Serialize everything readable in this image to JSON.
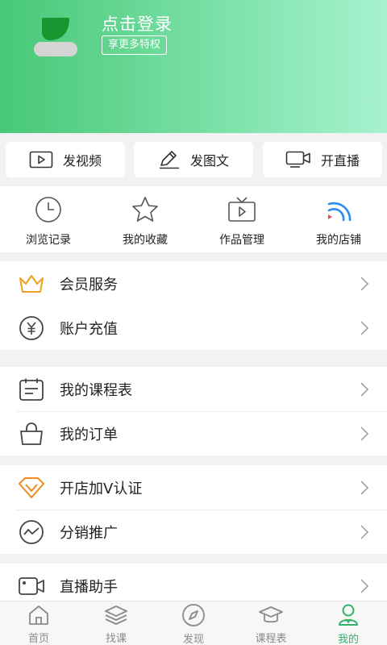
{
  "header": {
    "login_title": "点击登录",
    "privilege_badge": "享更多特权"
  },
  "quick_actions": [
    {
      "label": "发视频",
      "icon": "video-play-icon"
    },
    {
      "label": "发图文",
      "icon": "pen-icon"
    },
    {
      "label": "开直播",
      "icon": "live-camera-icon"
    }
  ],
  "shortcuts": [
    {
      "label": "浏览记录",
      "icon": "clock-icon"
    },
    {
      "label": "我的收藏",
      "icon": "star-icon"
    },
    {
      "label": "作品管理",
      "icon": "tv-icon"
    },
    {
      "label": "我的店铺",
      "icon": "signal-icon"
    }
  ],
  "menu": {
    "membership": "会员服务",
    "recharge": "账户充值",
    "schedule": "我的课程表",
    "orders": "我的订单",
    "v_certify": "开店加V认证",
    "distribution": "分销推广",
    "live_assistant": "直播助手"
  },
  "tabs": [
    {
      "label": "首页",
      "icon": "home-icon"
    },
    {
      "label": "找课",
      "icon": "layers-icon"
    },
    {
      "label": "发现",
      "icon": "compass-icon"
    },
    {
      "label": "课程表",
      "icon": "graduation-cap-icon"
    },
    {
      "label": "我的",
      "icon": "user-icon",
      "active": true
    }
  ],
  "colors": {
    "brand_green": "#2fb268",
    "header_start": "#47c877",
    "header_end": "#a8f2cf",
    "crown_orange": "#f0a020",
    "v_orange": "#f08c1e",
    "live_blue": "#2a8cf0",
    "live_red": "#f04848"
  }
}
